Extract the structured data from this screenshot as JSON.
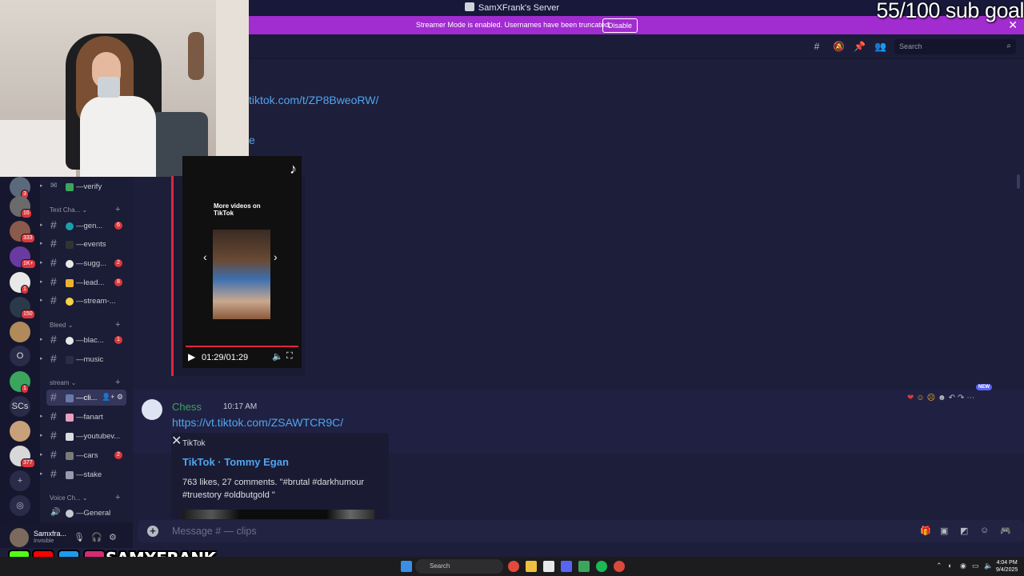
{
  "window": {
    "title": "SamXFrank's Server"
  },
  "overlay": {
    "sub_goal": "55/100 sub goal",
    "social_handle": "SAMXFRANK",
    "social_icons": [
      "kick-icon",
      "youtube-icon",
      "twitter-icon",
      "instagram-icon"
    ]
  },
  "banner": {
    "text": "Streamer Mode is enabled. Usernames have been truncated.",
    "disable_label": "Disable",
    "color": "#a12ccf"
  },
  "header": {
    "search_placeholder": "Search",
    "icons": [
      "threads-icon",
      "mute-icon",
      "pin-icon",
      "members-icon"
    ]
  },
  "servers": [
    {
      "label": "",
      "badge": "3"
    },
    {
      "label": "",
      "badge": "16"
    },
    {
      "label": "",
      "badge": "333"
    },
    {
      "label": "",
      "badge": "1K+"
    },
    {
      "label": "",
      "badge": "1"
    },
    {
      "label": "",
      "badge": "150"
    },
    {
      "label": "",
      "badge": ""
    },
    {
      "label": "O",
      "badge": ""
    },
    {
      "label": "",
      "badge": "1"
    },
    {
      "label": "SCs",
      "badge": ""
    },
    {
      "label": "",
      "badge": ""
    },
    {
      "label": "",
      "badge": "377"
    }
  ],
  "channels": {
    "verify": "—verify",
    "cat_text": "Text Cha...",
    "text": [
      {
        "name": "—gen...",
        "count": "6"
      },
      {
        "name": "—events",
        "count": ""
      },
      {
        "name": "—sugg...",
        "count": "2"
      },
      {
        "name": "—lead...",
        "count": "8"
      },
      {
        "name": "—stream-...",
        "count": ""
      }
    ],
    "cat_bleed": "Bleed",
    "bleed": [
      {
        "name": "—blac...",
        "count": "1"
      },
      {
        "name": "—music",
        "count": ""
      }
    ],
    "cat_stream": "stream",
    "stream": [
      {
        "name": "—cli...",
        "count": "",
        "active": true
      },
      {
        "name": "—fanart",
        "count": ""
      },
      {
        "name": "—youtubev...",
        "count": ""
      },
      {
        "name": "—cars",
        "count": "2"
      },
      {
        "name": "—stake",
        "count": ""
      }
    ],
    "cat_voice": "Voice Ch...",
    "voice": [
      {
        "name": "—General"
      }
    ]
  },
  "user": {
    "name": "Samxfra...",
    "status": "Invisible"
  },
  "messages": {
    "first_link": "tiktok.com/t/ZP8BweoRW/",
    "partial_text": "e",
    "video": {
      "more_text": "More videos on TikTok",
      "time": "01:29/01:29"
    },
    "second": {
      "author": "Chess",
      "time": "10:17 AM",
      "link": "https://vt.tiktok.com/ZSAWTCR9C/",
      "embed": {
        "provider": "TikTok",
        "title": "TikTok · Tommy Egan",
        "description": "763 likes, 27 comments. \"#brutal #darkhumour #truestory #oldbutgold \""
      }
    },
    "new_badge": "NEW"
  },
  "composer": {
    "placeholder": "Message # — clips"
  },
  "taskbar": {
    "search": "Search",
    "time": "4:04 PM",
    "date": "9/4/2025"
  }
}
